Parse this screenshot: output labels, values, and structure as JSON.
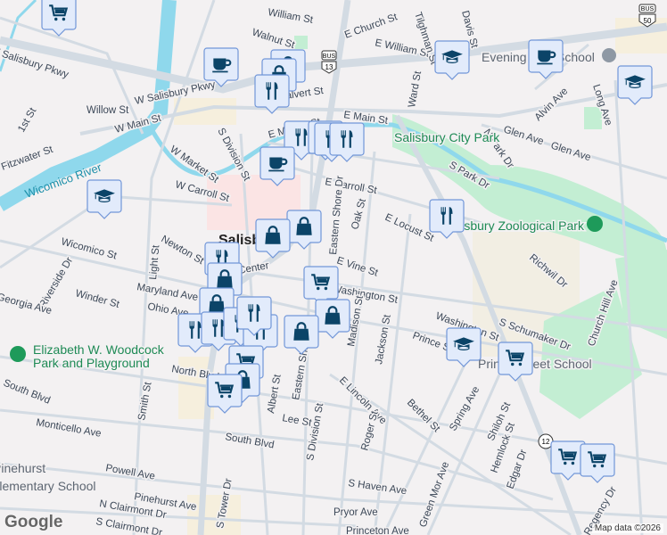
{
  "map": {
    "attribution": "Map data ©2026",
    "logo": "Google",
    "colors": {
      "background": "#f3f1f2",
      "road": "#d3dbe3",
      "water": "#8fd8ec",
      "park": "#c3eed3",
      "pin_fill": "#e2ebfb",
      "pin_border": "#7196d8",
      "icon": "#0b4468"
    },
    "shields": [
      "13",
      "BUS",
      "50",
      "12"
    ],
    "labels": {
      "streets": [
        "William St",
        "Walnut St",
        "E Church St",
        "E William St",
        "Tilghman St",
        "Davis St",
        "W Salisbury Pkwy",
        "W Salisbury Pkwy",
        "Calvert St",
        "Willow St",
        "W Main St",
        "E Main St",
        "E Market St",
        "1st St",
        "Fitzwater St",
        "W Market St",
        "S Division St",
        "W Carroll St",
        "E Carroll St",
        "Ward St",
        "Alvin Ave",
        "Long Ave",
        "Glen Ave",
        "Glen Ave",
        "N Park Dr",
        "S Park Dr",
        "Oak St",
        "Eastern Shore Dr",
        "E Locust St",
        "Richwil Dr",
        "E Vine St",
        "Washington St",
        "Washington St",
        "Wicomico St",
        "Newton St",
        "Light St",
        "Center",
        "Riverside Dr",
        "Winder St",
        "Georgia Ave",
        "Maryland Ave",
        "Ohio Ave",
        "North Blvd",
        "South Blvd",
        "Smith St",
        "Monticello Ave",
        "South Blvd",
        "Albert St",
        "Eastern Shore Dr",
        "Lee St",
        "S Division St",
        "Powell Ave",
        "Pinehurst Ave",
        "N Clairmont Dr",
        "S Clairmont Dr",
        "S Tower Dr",
        "Madison St",
        "Jackson St",
        "Prince St",
        "S Schumaker Dr",
        "Church Hill Ave",
        "E Lincoln Ave",
        "Bethel St",
        "Spring Ave",
        "Shiloh St",
        "Hemlock St",
        "Roger St",
        "Edgar Dr",
        "S Haven Ave",
        "Pryor Ave",
        "Princeton Ave",
        "Green Mor Ave",
        "Regency Dr"
      ],
      "parks": [
        "Salisbury City Park",
        "Salisbury Zoological Park",
        "Elizabeth W. Woodcock",
        "Park and Playground"
      ],
      "places": [
        "Evening Star School",
        "Prince Street School",
        "Pinehurst",
        "Elementary School"
      ],
      "city": "Salisbury",
      "water": "Wicomico River"
    },
    "markers": [
      "cart-icon",
      "coffee-icon",
      "shopping-bag-icon",
      "shopping-bag-icon",
      "restaurant-icon",
      "restaurant-icon",
      "restaurant-icon",
      "restaurant-icon",
      "restaurant-icon",
      "coffee-icon",
      "education-icon",
      "shopping-bag-icon",
      "shopping-bag-icon",
      "restaurant-icon",
      "shopping-bag-icon",
      "cart-icon",
      "shopping-bag-icon",
      "shopping-bag-icon",
      "restaurant-icon",
      "restaurant-icon",
      "restaurant-icon",
      "restaurant-icon",
      "restaurant-icon",
      "shopping-bag-icon",
      "cart-icon",
      "shopping-bag-icon",
      "cart-icon",
      "education-icon",
      "coffee-icon",
      "education-icon",
      "restaurant-icon",
      "education-icon",
      "cart-icon",
      "cart-icon",
      "cart-icon"
    ]
  }
}
